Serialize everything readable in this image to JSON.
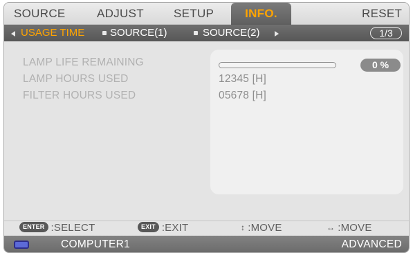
{
  "tabs": [
    {
      "label": "SOURCE",
      "active": false
    },
    {
      "label": "ADJUST",
      "active": false
    },
    {
      "label": "SETUP",
      "active": false
    },
    {
      "label": "INFO.",
      "active": true
    },
    {
      "label": "RESET",
      "active": false
    }
  ],
  "subtabs": [
    {
      "label": "USAGE TIME",
      "active": true
    },
    {
      "label": "SOURCE(1)",
      "active": false
    },
    {
      "label": "SOURCE(2)",
      "active": false
    }
  ],
  "page_indicator": "1/3",
  "rows": [
    {
      "label": "LAMP LIFE REMAINING",
      "value": "0 %"
    },
    {
      "label": "LAMP HOURS USED",
      "value": "12345 [H]"
    },
    {
      "label": "FILTER HOURS USED",
      "value": "05678 [H]"
    }
  ],
  "lamp_life_remaining_fraction": 0.0,
  "hints": [
    {
      "key": "ENTER",
      "text": ":SELECT"
    },
    {
      "key": "EXIT",
      "text": ":EXIT"
    },
    {
      "key": "up-down-arrow-icon",
      "text": ":MOVE"
    },
    {
      "key": "left-right-arrow-icon",
      "text": ":MOVE"
    }
  ],
  "status": {
    "source_icon": "computer-monitor-icon",
    "source_label": "COMPUTER1",
    "mode_label": "ADVANCED"
  },
  "colors": {
    "accent": "#ffa400",
    "background": "#e4e4e4",
    "bar_dark": "#606060"
  }
}
